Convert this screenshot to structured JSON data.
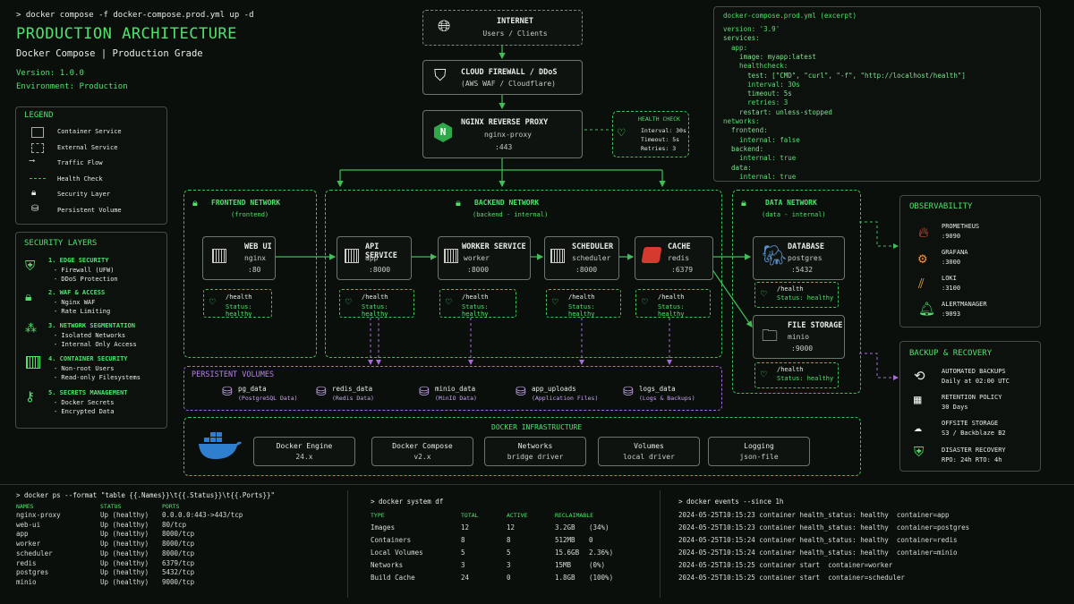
{
  "header": {
    "command_prompt": ">",
    "command": "docker compose -f docker-compose.prod.yml up -d",
    "title": "PRODUCTION ARCHITECTURE",
    "subtitle": "Docker Compose | Production Grade",
    "version": "Version: 1.0.0",
    "environment": "Environment: Production"
  },
  "legend": {
    "title": "LEGEND",
    "items": [
      "Container Service",
      "External Service",
      "Traffic Flow",
      "Health Check",
      "Security Layer",
      "Persistent Volume"
    ]
  },
  "security": {
    "title": "SECURITY LAYERS",
    "layers": [
      {
        "title": "1. EDGE SECURITY",
        "lines": [
          "- Firewall (UFW)",
          "- DDoS Protection"
        ]
      },
      {
        "title": "2. WAF & ACCESS",
        "lines": [
          "- Nginx WAF",
          "- Rate Limiting"
        ]
      },
      {
        "title": "3. NETWORK SEGMENTATION",
        "lines": [
          "- Isolated Networks",
          "- Internal Only Access"
        ]
      },
      {
        "title": "4. CONTAINER SECURITY",
        "lines": [
          "- Non-root Users",
          "- Read-only Filesystems"
        ]
      },
      {
        "title": "5. SECRETS MANAGEMENT",
        "lines": [
          "- Docker Secrets",
          "- Encrypted Data"
        ]
      }
    ]
  },
  "internet": {
    "title": "INTERNET",
    "sub": "Users / Clients"
  },
  "firewall": {
    "title": "CLOUD FIREWALL / DDoS",
    "sub": "(AWS WAF / Cloudflare)"
  },
  "proxy": {
    "title": "NGINX REVERSE PROXY",
    "sub": "nginx-proxy",
    "port": ":443"
  },
  "health_check": {
    "title": "HEALTH CHECK",
    "interval": "Interval: 30s",
    "timeout": "Timeout: 5s",
    "retries": "Retries: 3"
  },
  "compose_excerpt": {
    "title": "docker-compose.prod.yml (excerpt)",
    "lines": [
      "version: '3.9'",
      "services:",
      "  app:",
      "    image: myapp:latest",
      "    healthcheck:",
      "      test: [\"CMD\", \"curl\", \"-f\", \"http://localhost/health\"]",
      "      interval: 30s",
      "      timeout: 5s",
      "      retries: 3",
      "    restart: unless-stopped",
      "networks:",
      "  frontend:",
      "    internal: false",
      "  backend:",
      "    internal: true",
      "  data:",
      "    internal: true"
    ]
  },
  "frontend_net": {
    "title": "FRONTEND NETWORK",
    "sub": "(frontend)"
  },
  "backend_net": {
    "title": "BACKEND NETWORK",
    "sub": "(backend - internal)"
  },
  "data_net": {
    "title": "DATA NETWORK",
    "sub": "(data - internal)"
  },
  "services": {
    "webui": {
      "title": "WEB UI",
      "name": "nginx",
      "port": ":80"
    },
    "api": {
      "title": "API SERVICE",
      "name": "app",
      "port": ":8000"
    },
    "worker": {
      "title": "WORKER SERVICE",
      "name": "worker",
      "port": ":8000"
    },
    "scheduler": {
      "title": "SCHEDULER",
      "name": "scheduler",
      "port": ":8000"
    },
    "cache": {
      "title": "CACHE",
      "name": "redis",
      "port": ":6379"
    },
    "database": {
      "title": "DATABASE",
      "name": "postgres",
      "port": ":5432"
    },
    "storage": {
      "title": "FILE STORAGE",
      "name": "minio",
      "port": ":9000"
    }
  },
  "health": {
    "path": "/health",
    "status": "Status: healthy"
  },
  "volumes": {
    "title": "PERSISTENT VOLUMES",
    "items": [
      {
        "name": "pg_data",
        "desc": "(PostgreSQL Data)"
      },
      {
        "name": "redis_data",
        "desc": "(Redis Data)"
      },
      {
        "name": "minio_data",
        "desc": "(MinIO Data)"
      },
      {
        "name": "app_uploads",
        "desc": "(Application Files)"
      },
      {
        "name": "logs_data",
        "desc": "(Logs & Backups)"
      }
    ]
  },
  "infra": {
    "title": "DOCKER INFRASTRUCTURE",
    "items": [
      {
        "name": "Docker Engine",
        "value": "24.x"
      },
      {
        "name": "Docker Compose",
        "value": "v2.x"
      },
      {
        "name": "Networks",
        "value": "bridge driver"
      },
      {
        "name": "Volumes",
        "value": "local driver"
      },
      {
        "name": "Logging",
        "value": "json-file"
      }
    ]
  },
  "observability": {
    "title": "OBSERVABILITY",
    "items": [
      {
        "name": "PROMETHEUS",
        "port": ":9090"
      },
      {
        "name": "GRAFANA",
        "port": ":3000"
      },
      {
        "name": "LOKI",
        "port": ":3100"
      },
      {
        "name": "ALERTMANAGER",
        "port": ":9093"
      }
    ]
  },
  "backup": {
    "title": "BACKUP & RECOVERY",
    "items": [
      {
        "name": "AUTOMATED BACKUPS",
        "value": "Daily at 02:00 UTC"
      },
      {
        "name": "RETENTION POLICY",
        "value": "30 Days"
      },
      {
        "name": "OFFSITE STORAGE",
        "value": "S3 / Backblaze B2"
      },
      {
        "name": "DISASTER RECOVERY",
        "value": "RPO: 24h  RTO: 4h"
      }
    ]
  },
  "terminal_ps": {
    "command": "> docker ps --format \"table {{.Names}}\\t{{.Status}}\\t{{.Ports}}\"",
    "headers": [
      "NAMES",
      "STATUS",
      "PORTS"
    ],
    "rows": [
      [
        "nginx-proxy",
        "Up (healthy)",
        "0.0.0.0:443->443/tcp"
      ],
      [
        "web-ui",
        "Up (healthy)",
        "80/tcp"
      ],
      [
        "app",
        "Up (healthy)",
        "8000/tcp"
      ],
      [
        "worker",
        "Up (healthy)",
        "8000/tcp"
      ],
      [
        "scheduler",
        "Up (healthy)",
        "8000/tcp"
      ],
      [
        "redis",
        "Up (healthy)",
        "6379/tcp"
      ],
      [
        "postgres",
        "Up (healthy)",
        "5432/tcp"
      ],
      [
        "minio",
        "Up (healthy)",
        "9000/tcp"
      ]
    ]
  },
  "terminal_df": {
    "command": "> docker system df",
    "headers": [
      "TYPE",
      "TOTAL",
      "ACTIVE",
      "RECLAIMABLE"
    ],
    "rows": [
      [
        "Images",
        "12",
        "12",
        "3.2GB",
        "(34%)"
      ],
      [
        "Containers",
        "8",
        "8",
        "512MB",
        "0"
      ],
      [
        "Local Volumes",
        "5",
        "5",
        "15.6GB",
        "2.36%)"
      ],
      [
        "Networks",
        "3",
        "3",
        "15MB",
        "(0%)"
      ],
      [
        "Build Cache",
        "24",
        "0",
        "1.8GB",
        "(100%)"
      ]
    ]
  },
  "terminal_events": {
    "command": "> docker events --since 1h",
    "rows": [
      "2024-05-25T10:15:23 container health_status: healthy  container=app",
      "2024-05-25T10:15:23 container health_status: healthy  container=postgres",
      "2024-05-25T10:15:24 container health_status: healthy  container=redis",
      "2024-05-25T10:15:24 container health_status: healthy  container=minio",
      "2024-05-25T10:15:25 container start  container=worker",
      "2024-05-25T10:15:25 container start  container=scheduler"
    ]
  }
}
